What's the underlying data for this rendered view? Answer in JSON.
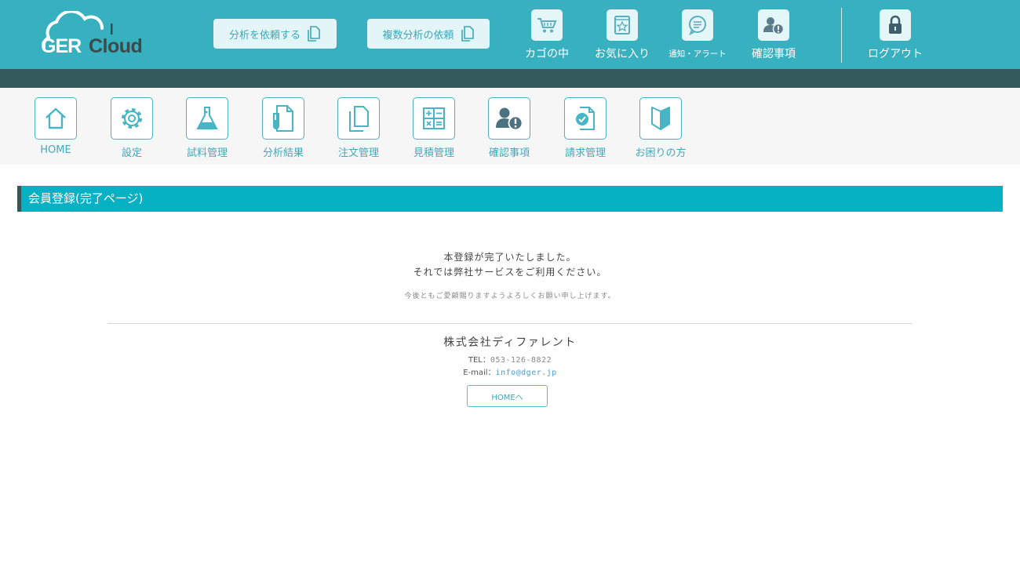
{
  "header": {
    "logo_text": "GER Cloud",
    "buttons": [
      {
        "label": "分析を依頼する"
      },
      {
        "label": "複数分析の依頼"
      }
    ],
    "icons": [
      {
        "label": "カゴの中",
        "icon": "cart-icon"
      },
      {
        "label": "お気に入り",
        "icon": "favorite-star-icon"
      },
      {
        "label": "通知・アラート",
        "icon": "chat-bubble-icon"
      },
      {
        "label": "確認事項",
        "icon": "user-alert-icon"
      }
    ],
    "logout": {
      "label": "ログアウト",
      "icon": "lock-icon"
    }
  },
  "nav": {
    "items": [
      {
        "label": "HOME",
        "icon": "home-icon"
      },
      {
        "label": "設定",
        "icon": "gear-icon"
      },
      {
        "label": "試料管理",
        "icon": "flask-icon"
      },
      {
        "label": "分析結果",
        "icon": "test-tube-doc-icon"
      },
      {
        "label": "注文管理",
        "icon": "copy-docs-icon"
      },
      {
        "label": "見積管理",
        "icon": "calculator-icon"
      },
      {
        "label": "確認事項",
        "icon": "user-alert-icon"
      },
      {
        "label": "請求管理",
        "icon": "doc-check-icon"
      },
      {
        "label": "お困りの方",
        "icon": "beginner-mark-icon"
      }
    ]
  },
  "page": {
    "title": "会員登録(完了ページ)",
    "message_line1": "本登録が完了いたしました。",
    "message_line2": "それでは弊社サービスをご利用ください。",
    "message_sub": "今後ともご愛顧賜りますようよろしくお願い申し上げます。"
  },
  "company": {
    "name": "株式会社ディファレント",
    "tel_label": "TEL：",
    "tel": "053-126-8822",
    "email_label": "E-mail：",
    "email": "info@dger.jp"
  },
  "home_button": {
    "label": "HOMEへ"
  },
  "colors": {
    "header_bg": "#37b0c0",
    "strip_bg": "#355a5e",
    "title_bar_bg": "#05b1c2",
    "accent": "#3aa8b8"
  }
}
